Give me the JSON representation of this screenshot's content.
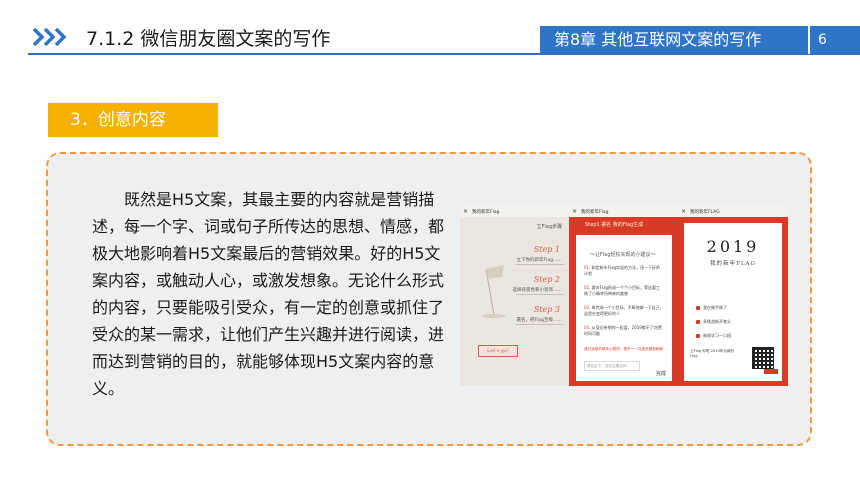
{
  "header": {
    "section_title": "7.1.2  微信朋友圈文案的写作",
    "chapter": "第8章   其他互联网文案的写作",
    "page_number": "6",
    "accent_color": "#2e74c9",
    "icon": "double-chevron-right-icon"
  },
  "section_badge": {
    "label": "3．创意内容",
    "color": "#f6b000"
  },
  "body": {
    "paragraph": "既然是H5文案，其最主要的内容就是营销描述，每一个字、词或句子所传达的思想、情感，都极大地影响着H5文案最后的营销效果。好的H5文案内容，或触动人心，或激发想象。无论什么形式的内容，只要能吸引受众，有一定的创意或抓住了受众的某一需求，让他们产生兴趣并进行阅读，进而达到营销的目的，就能够体现H5文案内容的意义。"
  },
  "phones": {
    "phone1": {
      "title": "我的新年Flag",
      "subtitle": "立Flag步骤",
      "steps": [
        {
          "label": "Step 1",
          "desc": "立下你的新年Flag……"
        },
        {
          "label": "Step 2",
          "desc": "选择背景色和小装饰……"
        },
        {
          "label": "Step 3",
          "desc": "署名，把Flag至每……"
        }
      ],
      "button": "Let's go!"
    },
    "phone2": {
      "title": "我的新年Flag",
      "tabs": "Step1  署名  我的Flag生成",
      "heading": "～让Flag轻松实现的小建议～",
      "items": [
        {
          "num": "01.",
          "text": "制定新年Flag实现的方法，逐一下好的计划"
        },
        {
          "num": "02.",
          "text": "要对Flag拆成一个个小目标，等这要工做了小确幸所带来的美感"
        },
        {
          "num": "03.",
          "text": "每完成一个小目标，不断地做一下自己，这是在变得更好的人"
        },
        {
          "num": "04.",
          "text": "从身边亲朋的一起监，2019都不了花费时间可能"
        }
      ],
      "check": "我已读取的新年心愿的，想开一一并逐步做到刷新",
      "input": "请在此下，还在后看这吗",
      "done": "完成"
    },
    "phone3": {
      "title": "我的新年FLAG",
      "year": "2019",
      "subtitle": "我的新年FLAG",
      "items": [
        "我在做手账了",
        "多挑战新开笔头",
        "每周学习一口园"
      ],
      "footer": "立Flag 你呢 2019年为新的Flag"
    }
  }
}
